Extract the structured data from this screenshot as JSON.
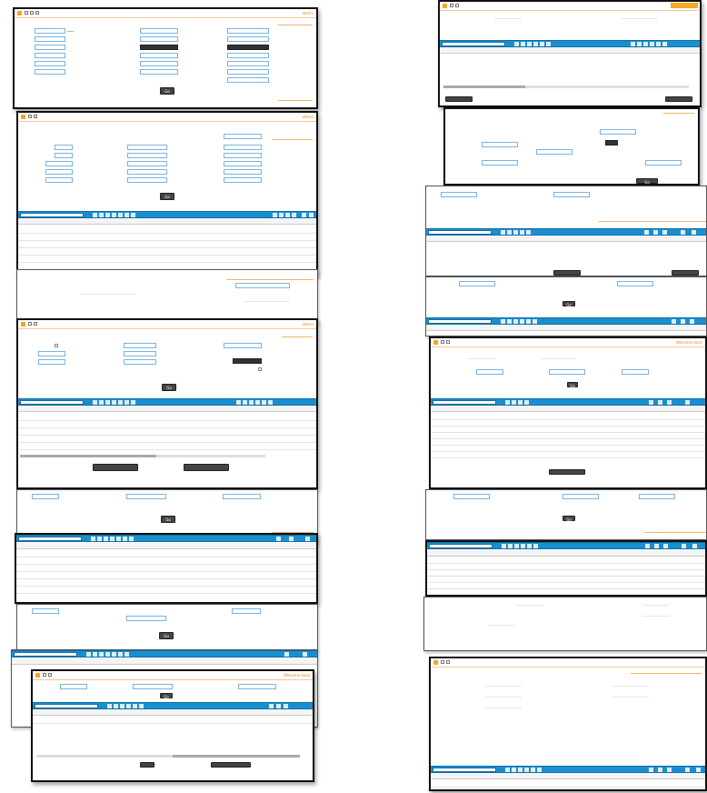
{
  "ui": {
    "search_button": "Go",
    "user_label": "admin",
    "username_orange": "Welcome back",
    "toolbar_glyphs": [
      "□",
      "□",
      "□"
    ],
    "pagination_marks": "■ ■ ■ ■ ■ ■ ■",
    "nav_marks": "■ ■ ■ ■"
  },
  "colors": {
    "accent_orange": "#f5a623",
    "grid_blue": "#1a8fd0",
    "border_dark": "#111111"
  },
  "icons": [
    "logo-icon",
    "home-icon",
    "list-icon",
    "settings-icon"
  ]
}
